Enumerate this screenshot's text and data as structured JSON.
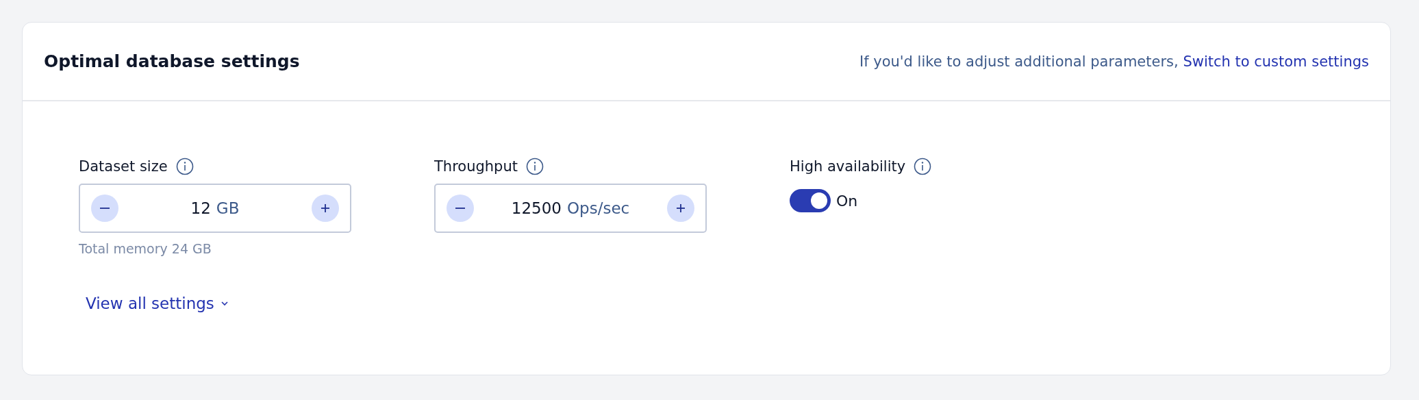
{
  "card": {
    "title": "Optimal database settings",
    "hint": {
      "text": "If you'd like to adjust additional parameters,",
      "link": "Switch to custom settings"
    }
  },
  "settings": [
    {
      "kind": "stepper",
      "label": "Dataset size",
      "value": "12",
      "unit": "GB",
      "note": "Total memory 24 GB"
    },
    {
      "kind": "stepper",
      "label": "Throughput",
      "value": "12500",
      "unit": "Ops/sec"
    },
    {
      "kind": "toggle",
      "label": "High availability",
      "on": true,
      "state_label": "On"
    }
  ],
  "view_all": {
    "label": "View all settings",
    "expanded": false
  }
}
